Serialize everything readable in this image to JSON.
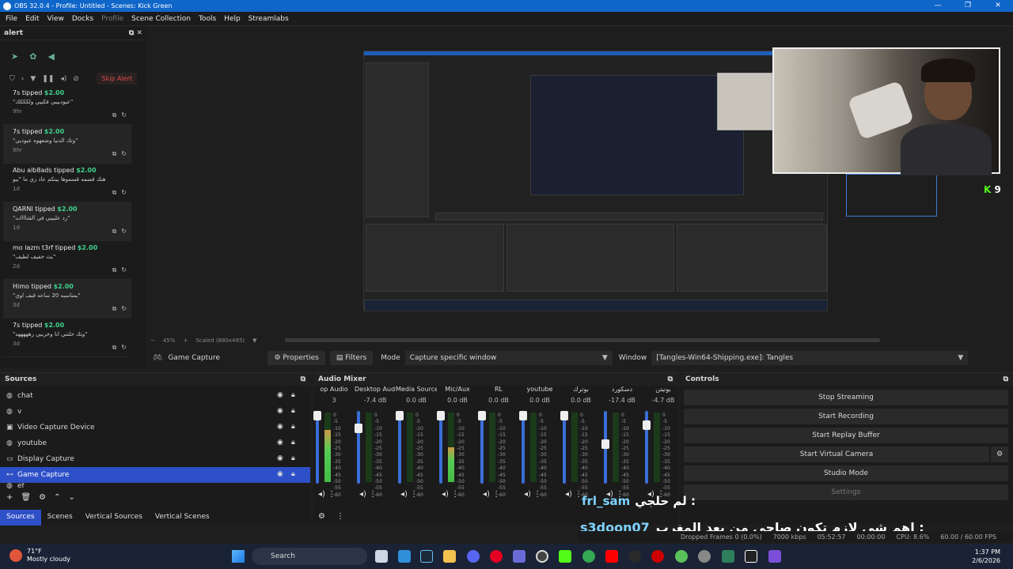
{
  "window": {
    "title": "OBS 32.0.4 - Profile: Untitled - Scenes: Kick Green",
    "controls": [
      "—",
      "❐",
      "✕"
    ]
  },
  "menu": [
    "File",
    "Edit",
    "View",
    "Docks",
    "Profile",
    "Scene Collection",
    "Tools",
    "Help",
    "Streamlabs"
  ],
  "alert_dock": {
    "title": "alert",
    "skip_label": "Skip Alert",
    "items": [
      {
        "name": "7s",
        "action": "tipped",
        "amount": "$2.00",
        "msg": "\"عيوديييي فكييي ولكككك\"",
        "when": "9hr"
      },
      {
        "name": "7s",
        "action": "tipped",
        "amount": "$2.00",
        "msg": "\"وتك الدنيا وضعهوه عيوديي\"",
        "when": "9hr"
      },
      {
        "name": "Abu alb8ads",
        "action": "tipped",
        "amount": "$2.00",
        "msg": "هنك قسمه قسموها بينكم عاد زي ما \"يبو",
        "when": "1d"
      },
      {
        "name": "QARNI",
        "action": "tipped",
        "amount": "$2.00",
        "msg": "\"رد عليييي في الشاااات\"",
        "when": "1d"
      },
      {
        "name": "mo lazm t3rf",
        "action": "tipped",
        "amount": "$2.00",
        "msg": "\"يث خفيف لطيف\"",
        "when": "2d"
      },
      {
        "name": "Himo",
        "action": "tipped",
        "amount": "$2.00",
        "msg": "\"بمناسبه 20 ساعه قيف اوي\"",
        "when": "3d"
      },
      {
        "name": "7s",
        "action": "tipped",
        "amount": "$2.00",
        "msg": "\"وتك حلتني انا وخربيي رهههههه\"",
        "when": "3d"
      }
    ]
  },
  "preview": {
    "zoom": "45%",
    "scaled": "Scaled (880x495)",
    "kick_count": "9"
  },
  "source_bar": {
    "source_name": "Game Capture",
    "properties": "Properties",
    "filters": "Filters",
    "mode_label": "Mode",
    "mode_value": "Capture specific window",
    "window_label": "Window",
    "window_value": "[Tangles-Win64-Shipping.exe]: Tangles"
  },
  "sources": {
    "title": "Sources",
    "items": [
      {
        "name": "chat",
        "icon": "globe-icon"
      },
      {
        "name": "v",
        "icon": "globe-icon"
      },
      {
        "name": "Video Capture Device",
        "icon": "camera-icon"
      },
      {
        "name": "youtube",
        "icon": "globe-icon"
      },
      {
        "name": "Display Capture",
        "icon": "monitor-icon"
      },
      {
        "name": "Game Capture",
        "icon": "gamepad-icon",
        "selected": true
      }
    ],
    "partial_item": "ef"
  },
  "dock_tabs": [
    "Sources",
    "Scenes",
    "Vertical Sources",
    "Vertical Scenes"
  ],
  "mixer": {
    "title": "Audio Mixer",
    "channels": [
      {
        "name": "op Audio",
        "db": "3",
        "level": 0.75,
        "fader": 0.0
      },
      {
        "name": "Desktop Audio 2",
        "db": "-7.4 dB",
        "level": 0.0,
        "fader": 0.2
      },
      {
        "name": "Media Source",
        "db": "0.0 dB",
        "level": 0.0,
        "fader": 0.0
      },
      {
        "name": "Mic/Aux",
        "db": "0.0 dB",
        "level": 0.5,
        "fader": 0.0
      },
      {
        "name": "RL",
        "db": "0.0 dB",
        "level": 0.0,
        "fader": 0.0
      },
      {
        "name": "youtube",
        "db": "0.0 dB",
        "level": 0.0,
        "fader": 0.0
      },
      {
        "name": "بوترك",
        "db": "0.0 dB",
        "level": 0.0,
        "fader": 0.0
      },
      {
        "name": "دسكورد",
        "db": "-17.4 dB",
        "level": 0.0,
        "fader": 0.45
      },
      {
        "name": "بونيتن",
        "db": "-4.7 dB",
        "level": 0.0,
        "fader": 0.15
      }
    ],
    "scale": [
      "0",
      "-5",
      "-10",
      "-15",
      "-20",
      "-25",
      "-30",
      "-35",
      "-40",
      "-45",
      "-50",
      "-55",
      "-60"
    ]
  },
  "controls": {
    "title": "Controls",
    "buttons": [
      "Stop Streaming",
      "Start Recording",
      "Start Replay Buffer",
      "Start Virtual Camera",
      "Studio Mode",
      "Settings"
    ]
  },
  "chat": {
    "line1_user": "frl_sam",
    "line1_text": "لم حلجي :",
    "line2_user": "s3doon07",
    "line2_text": "اهم شي لازم تكون صاحي من بعد المغرب :"
  },
  "status": {
    "dropped": "Dropped Frames 0 (0.0%)",
    "kbps": "7000 kbps",
    "live_time": "05:52:57",
    "rec_time": "00:00:00",
    "cpu": "CPU: 8.6%",
    "fps": "60.00 / 60.00 FPS"
  },
  "taskbar": {
    "temp": "71°F",
    "weather": "Mostly cloudy",
    "search": "Search",
    "time": "1:37 PM",
    "date": "2/6/2026"
  }
}
